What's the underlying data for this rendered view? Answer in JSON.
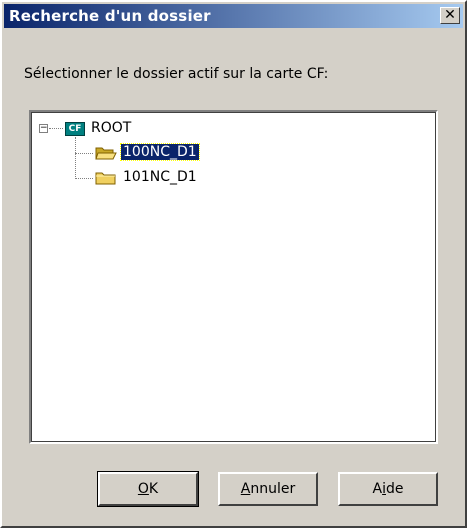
{
  "window": {
    "title": "Recherche d'un dossier",
    "close_glyph": "✕"
  },
  "prompt": "Sélectionner le dossier actif sur la carte CF:",
  "tree": {
    "root": {
      "label": "ROOT",
      "icon": "cf-card-icon",
      "icon_text": "CF",
      "expander": "−"
    },
    "children": [
      {
        "label": "100NC_D1",
        "icon": "open-folder-icon",
        "selected": true
      },
      {
        "label": "101NC_D1",
        "icon": "folder-icon",
        "selected": false
      }
    ]
  },
  "buttons": {
    "ok": {
      "mnemonic": "O",
      "rest": "K"
    },
    "cancel": {
      "mnemonic": "A",
      "rest": "nnuler"
    },
    "help": {
      "pre": "A",
      "mnemonic": "i",
      "rest": "de"
    }
  },
  "colors": {
    "titlebar_start": "#0a246a",
    "titlebar_end": "#a6caf0",
    "face": "#d4d0c8",
    "selection": "#0a246a",
    "folder": "#f0d060"
  }
}
